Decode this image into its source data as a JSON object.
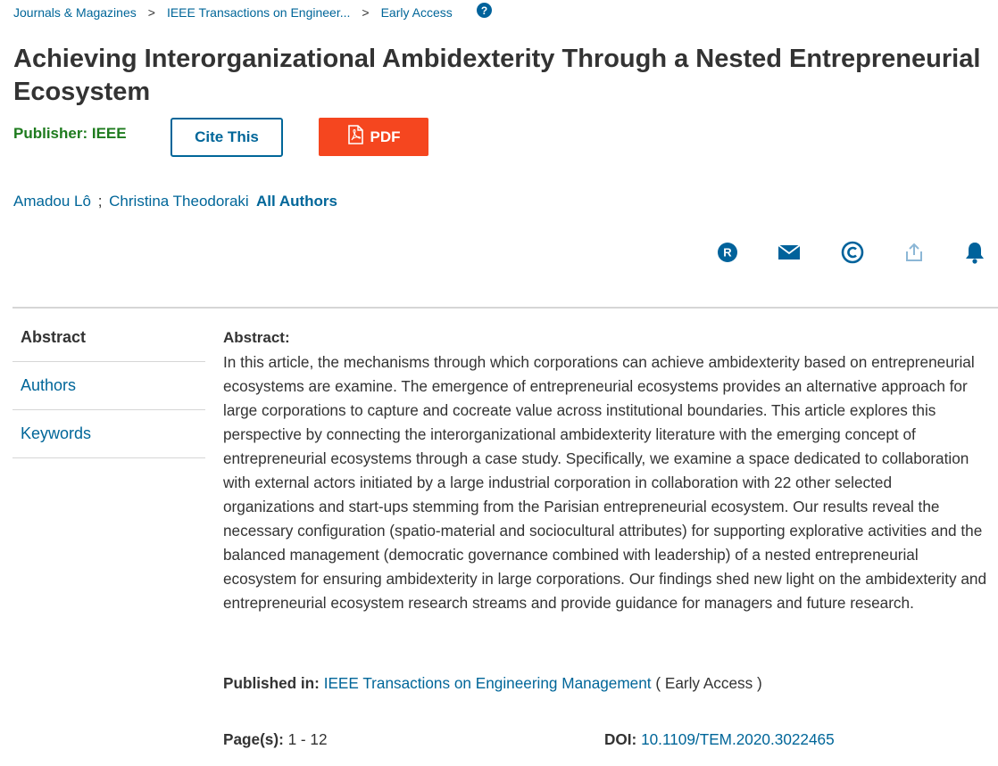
{
  "breadcrumb": {
    "items": [
      "Journals & Magazines",
      "IEEE Transactions on Engineer...",
      "Early Access"
    ],
    "separator": ">"
  },
  "help_icon": {
    "name": "help-icon",
    "glyph": "?"
  },
  "article": {
    "title": "Achieving Interorganizational Ambidexterity Through a Nested Entrepreneurial Ecosystem",
    "publisher": "Publisher: IEEE",
    "cite_label": "Cite This",
    "pdf_label": "PDF",
    "authors": [
      "Amadou Lô",
      "Christina Theodoraki"
    ],
    "author_separator": ";",
    "all_authors_label": "All Authors"
  },
  "actions": [
    {
      "name": "rights-permissions-icon",
      "color": "#00629b"
    },
    {
      "name": "email-icon",
      "color": "#00629b"
    },
    {
      "name": "copyright-icon",
      "color": "#00629b"
    },
    {
      "name": "share-icon",
      "color": "#8cb7d6"
    },
    {
      "name": "alerts-bell-icon",
      "color": "#00629b"
    }
  ],
  "sidenav": {
    "items": [
      "Abstract",
      "Authors",
      "Keywords"
    ],
    "active": "Abstract"
  },
  "abstract": {
    "heading": "Abstract:",
    "text": "In this article, the mechanisms through which corporations can achieve ambidexterity based on entrepreneurial ecosystems are examine. The emergence of entrepreneurial ecosystems provides an alternative approach for large corporations to capture and cocreate value across institutional boundaries. This article explores this perspective by connecting the interorganizational ambidexterity literature with the emerging concept of entrepreneurial ecosystems through a case study. Specifically, we examine a space dedicated to collaboration with external actors initiated by a large industrial corporation in collaboration with 22 other selected organizations and start-ups stemming from the Parisian entrepreneurial ecosystem. Our results reveal the necessary configuration (spatio-material and sociocultural attributes) for supporting explorative activities and the balanced management (democratic governance combined with leadership) of a nested entrepreneurial ecosystem for ensuring ambidexterity in large corporations. Our findings shed new light on the ambidexterity and entrepreneurial ecosystem research streams and provide guidance for managers and future research."
  },
  "details": {
    "published_in_label": "Published in:",
    "journal": "IEEE Transactions on Engineering Management",
    "status": "( Early Access )",
    "pages_label": "Page(s):",
    "pages": "1 - 12",
    "doi_label": "DOI:",
    "doi": "10.1109/TEM.2020.3022465"
  },
  "colors": {
    "link": "#006699",
    "publisher_green": "#1e7b1e",
    "pdf_button": "#f5461f",
    "divider": "#d6d6d6"
  }
}
